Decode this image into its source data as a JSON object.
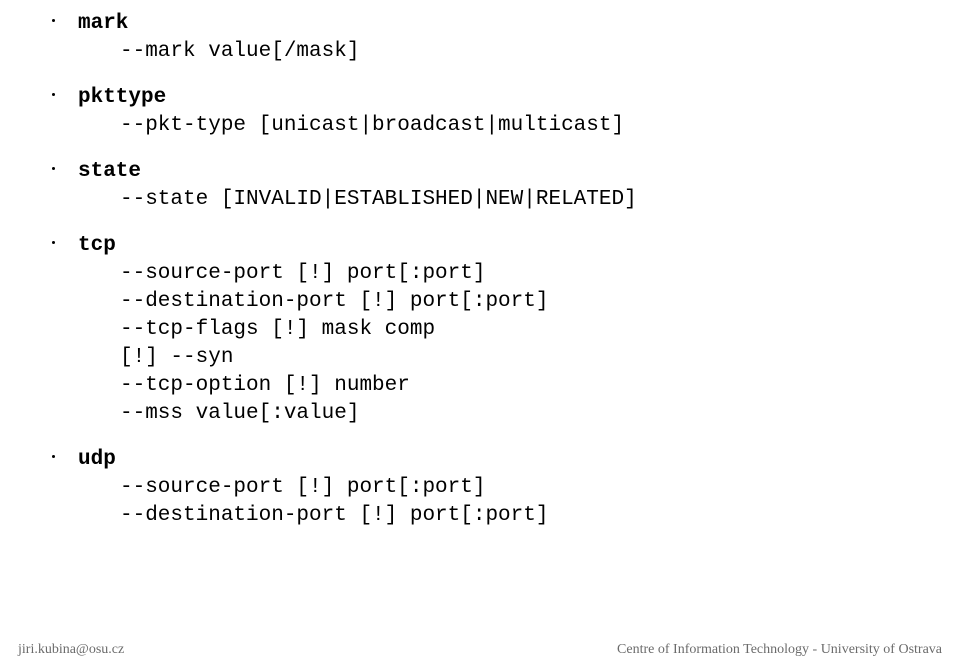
{
  "sections": [
    {
      "title": "mark",
      "body": "--mark value[/mask]"
    },
    {
      "title": "pkttype",
      "body": "--pkt-type [unicast|broadcast|multicast]"
    },
    {
      "title": "state",
      "body": "--state [INVALID|ESTABLISHED|NEW|RELATED]"
    },
    {
      "title": "tcp",
      "body": "--source-port [!] port[:port]\n--destination-port [!] port[:port]\n--tcp-flags [!] mask comp\n[!] --syn\n--tcp-option [!] number\n--mss value[:value]"
    },
    {
      "title": "udp",
      "body": "--source-port [!] port[:port]\n--destination-port [!] port[:port]"
    }
  ],
  "footer": {
    "left": "jiri.kubina@osu.cz",
    "right": "Centre of Information Technology - University of Ostrava"
  }
}
